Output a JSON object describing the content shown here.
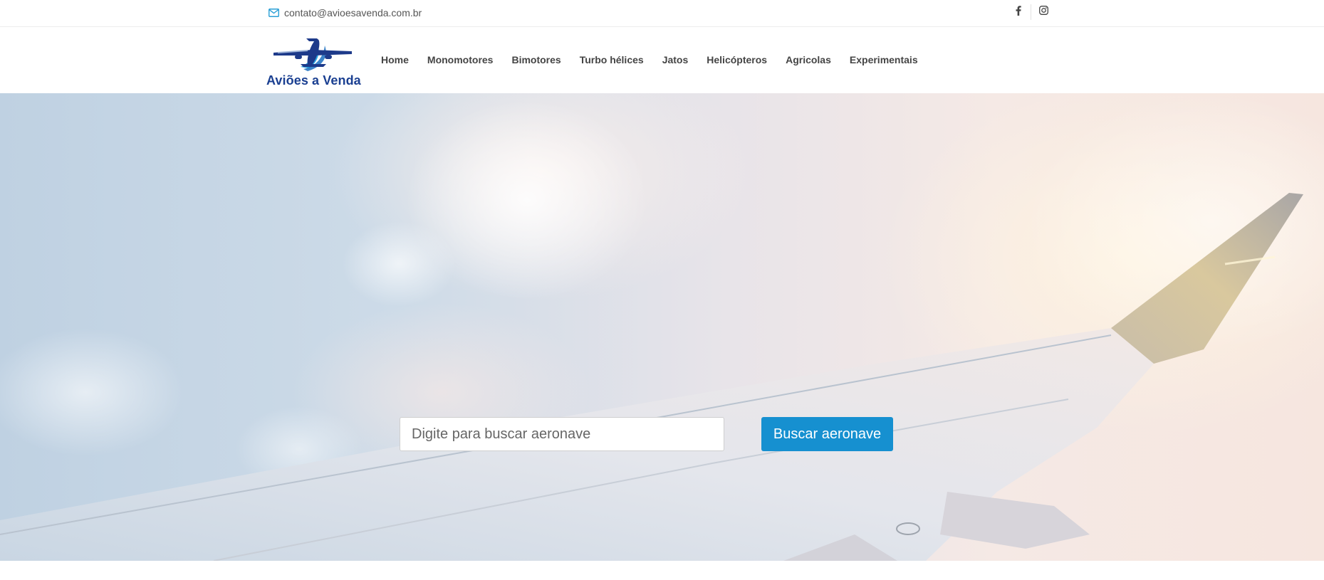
{
  "topbar": {
    "email": "contato@avioesavenda.com.br",
    "email_icon": "envelope-icon",
    "social": [
      {
        "name": "facebook-icon"
      },
      {
        "name": "instagram-icon"
      }
    ]
  },
  "header": {
    "logo_text": "Aviões a Venda",
    "nav": [
      {
        "label": "Home"
      },
      {
        "label": "Monomotores"
      },
      {
        "label": "Bimotores"
      },
      {
        "label": "Turbo hélices"
      },
      {
        "label": "Jatos"
      },
      {
        "label": "Helicópteros"
      },
      {
        "label": "Agricolas"
      },
      {
        "label": "Experimentais"
      }
    ]
  },
  "hero": {
    "search_placeholder": "Digite para buscar aeronave",
    "search_value": "",
    "search_button_label": "Buscar aeronave"
  },
  "colors": {
    "brand_blue": "#1a3f91",
    "button_blue": "#1690d0",
    "email_icon": "#2a9fd6"
  }
}
